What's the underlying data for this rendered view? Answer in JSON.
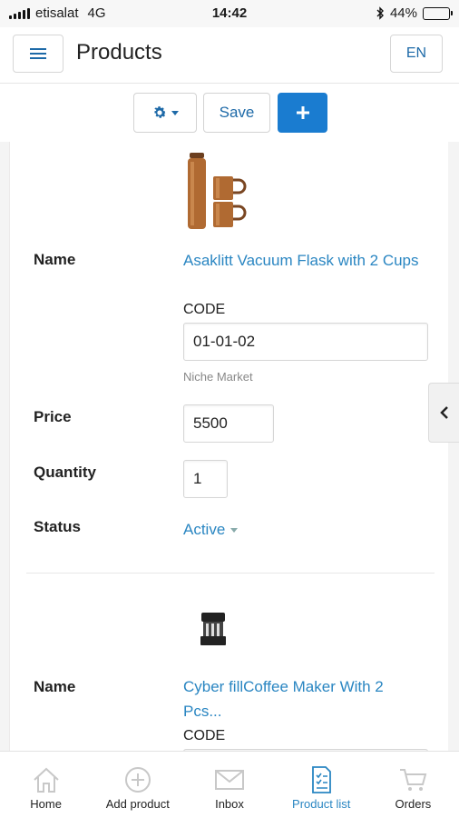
{
  "status_bar": {
    "carrier": "etisalat",
    "network": "4G",
    "time": "14:42",
    "battery_percent": "44%",
    "battery_level": 0.44
  },
  "header": {
    "title": "Products",
    "language_button": "EN"
  },
  "toolbar": {
    "save_label": "Save",
    "add_icon": "plus-icon",
    "settings_icon": "gear-icon"
  },
  "products": [
    {
      "name_label": "Name",
      "name": "Asaklitt Vacuum Flask with 2 Cups",
      "code_label": "CODE",
      "code_value": "01-01-02",
      "market": "Niche Market",
      "price_label": "Price",
      "price_value": "5500",
      "quantity_label": "Quantity",
      "quantity_value": "1",
      "status_label": "Status",
      "status_value": "Active"
    },
    {
      "name_label": "Name",
      "name": "Cyber fillCoffee Maker With 2 Pcs...",
      "code_label": "CODE"
    }
  ],
  "bottom_nav": {
    "items": [
      {
        "label": "Home",
        "icon": "home-icon"
      },
      {
        "label": "Add product",
        "icon": "add-circle-icon"
      },
      {
        "label": "Inbox",
        "icon": "envelope-icon"
      },
      {
        "label": "Product list",
        "icon": "list-icon",
        "active": true
      },
      {
        "label": "Orders",
        "icon": "cart-icon"
      }
    ]
  },
  "colors": {
    "accent": "#2a86c2",
    "primary_button": "#1a7cd0",
    "header_icon": "#1e6aa8"
  }
}
